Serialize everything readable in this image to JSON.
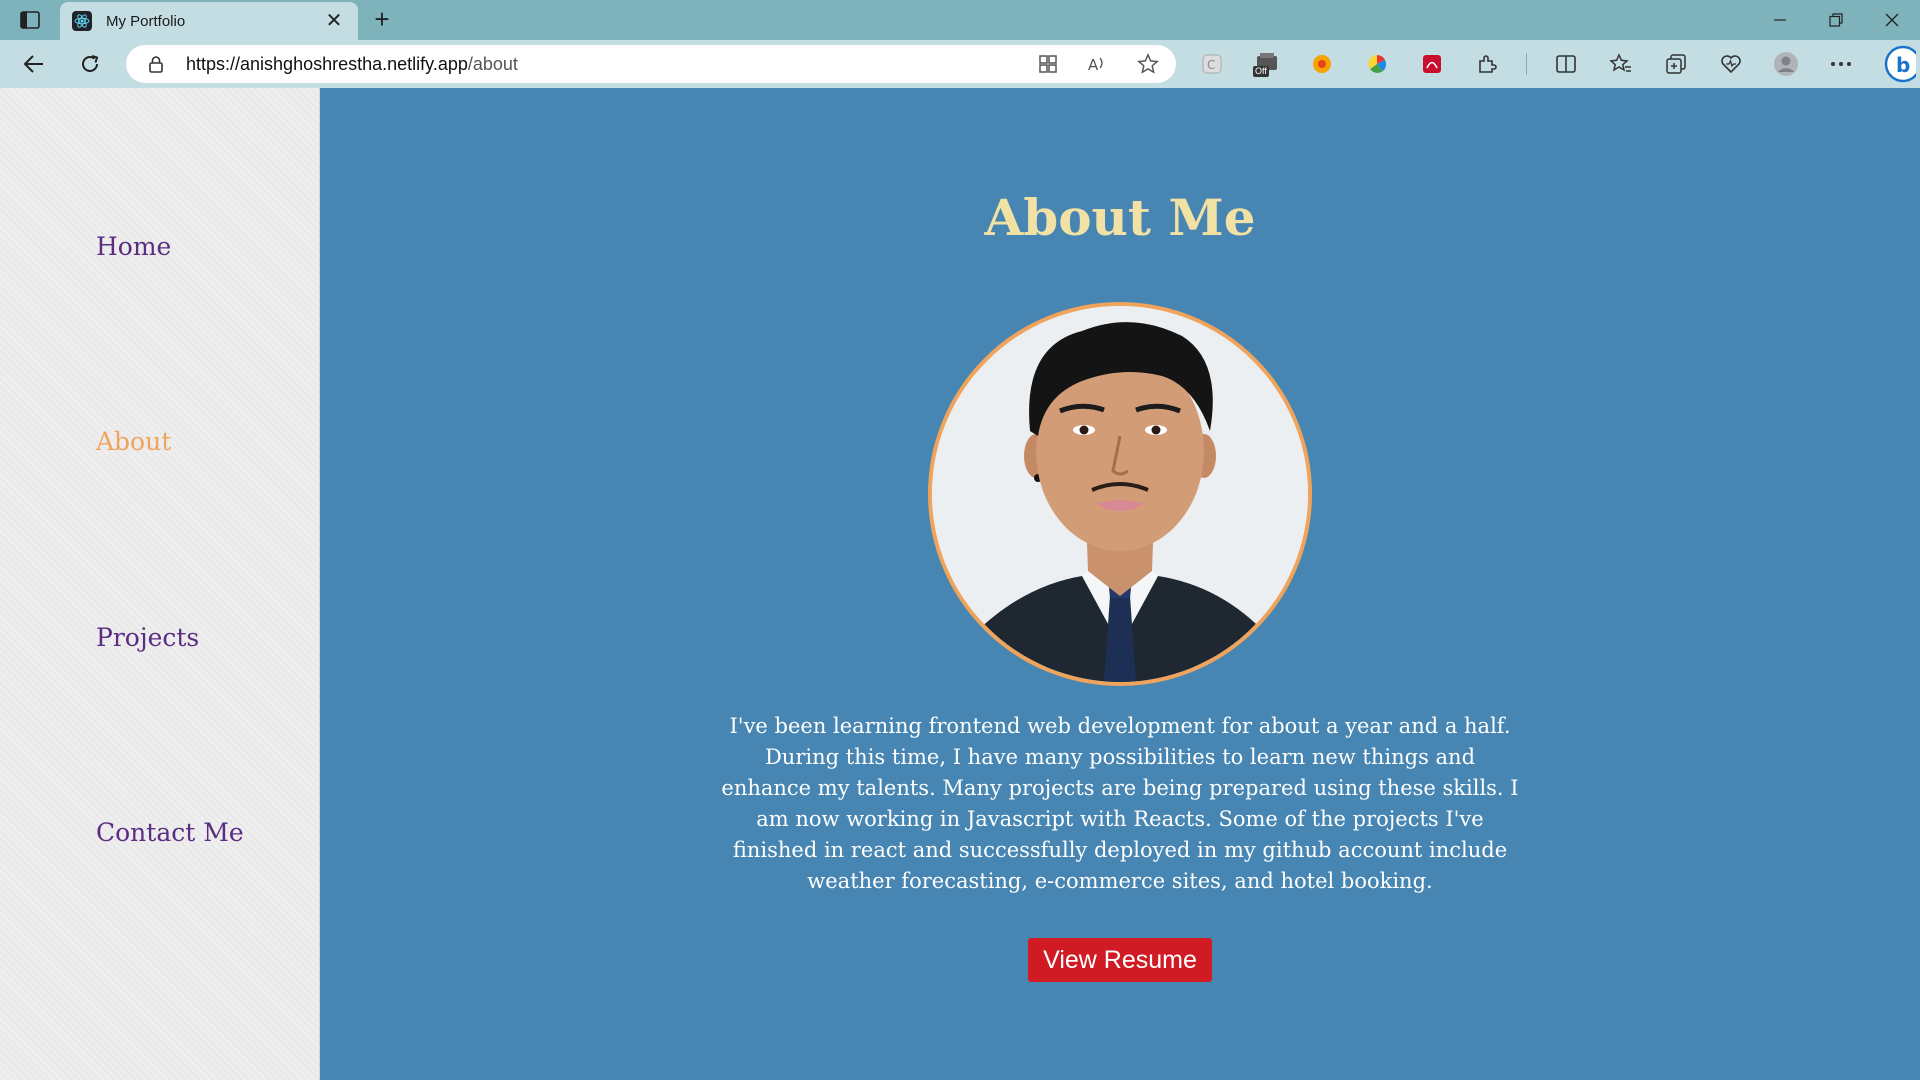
{
  "browser": {
    "tab_title": "My Portfolio",
    "url_host": "https://anishghoshrestha.netlify.app",
    "url_path": "/about",
    "extension_badge": "Off"
  },
  "sidebar": {
    "items": [
      {
        "label": "Home",
        "active": false
      },
      {
        "label": "About",
        "active": true
      },
      {
        "label": "Projects",
        "active": false
      },
      {
        "label": "Contact Me",
        "active": false
      }
    ]
  },
  "main": {
    "heading": "About Me",
    "bio": "I've been learning frontend web development for about a year and a half. During this time, I have many possibilities to learn new things and enhance my talents. Many projects are being prepared using these skills. I am now working in Javascript with Reacts. Some of the projects I've finished in react and successfully deployed in my github account include weather forecasting, e-commerce sites, and hotel booking.",
    "resume_button": "View Resume"
  },
  "colors": {
    "accent": "#f0a35a",
    "nav_link": "#5a2d82",
    "main_bg": "#4786b2",
    "heading": "#f1e1a5",
    "button": "#d11b24"
  }
}
